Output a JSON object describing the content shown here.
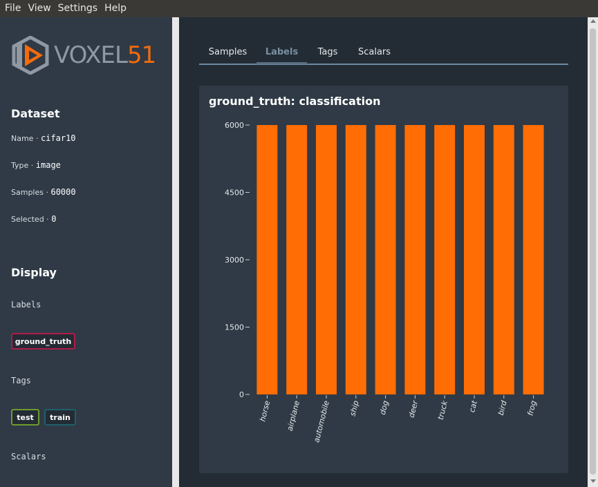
{
  "menu": [
    "File",
    "View",
    "Settings",
    "Help"
  ],
  "logo": {
    "word": "VOXEL",
    "number": "51",
    "brand_color": "#f36b0d"
  },
  "sidebar": {
    "dataset_heading": "Dataset",
    "dataset": [
      {
        "key": "Name",
        "value": "cifar10"
      },
      {
        "key": "Type",
        "value": "image"
      },
      {
        "key": "Samples",
        "value": "60000"
      },
      {
        "key": "Selected",
        "value": "0"
      }
    ],
    "display_heading": "Display",
    "labels_heading": "Labels",
    "labels": [
      {
        "name": "ground_truth",
        "color": "#b01b4a"
      }
    ],
    "tags_heading": "Tags",
    "tags": [
      {
        "name": "test",
        "color": "#6f9a2e"
      },
      {
        "name": "train",
        "color": "#1f5f6b"
      }
    ],
    "scalars_heading": "Scalars"
  },
  "tabs": [
    {
      "label": "Samples",
      "active": false
    },
    {
      "label": "Labels",
      "active": true
    },
    {
      "label": "Tags",
      "active": false
    },
    {
      "label": "Scalars",
      "active": false
    }
  ],
  "panel": {
    "title": "ground_truth: classification"
  },
  "chart_data": {
    "type": "bar",
    "title": "ground_truth: classification",
    "categories": [
      "horse",
      "airplane",
      "automobile",
      "ship",
      "dog",
      "deer",
      "truck",
      "cat",
      "bird",
      "frog"
    ],
    "values": [
      6000,
      6000,
      6000,
      6000,
      6000,
      6000,
      6000,
      6000,
      6000,
      6000
    ],
    "yticks": [
      0,
      1500,
      3000,
      4500,
      6000
    ],
    "ylim": [
      0,
      6000
    ],
    "bar_color": "#ff6d04",
    "grid": false,
    "xlabel": "",
    "ylabel": ""
  }
}
